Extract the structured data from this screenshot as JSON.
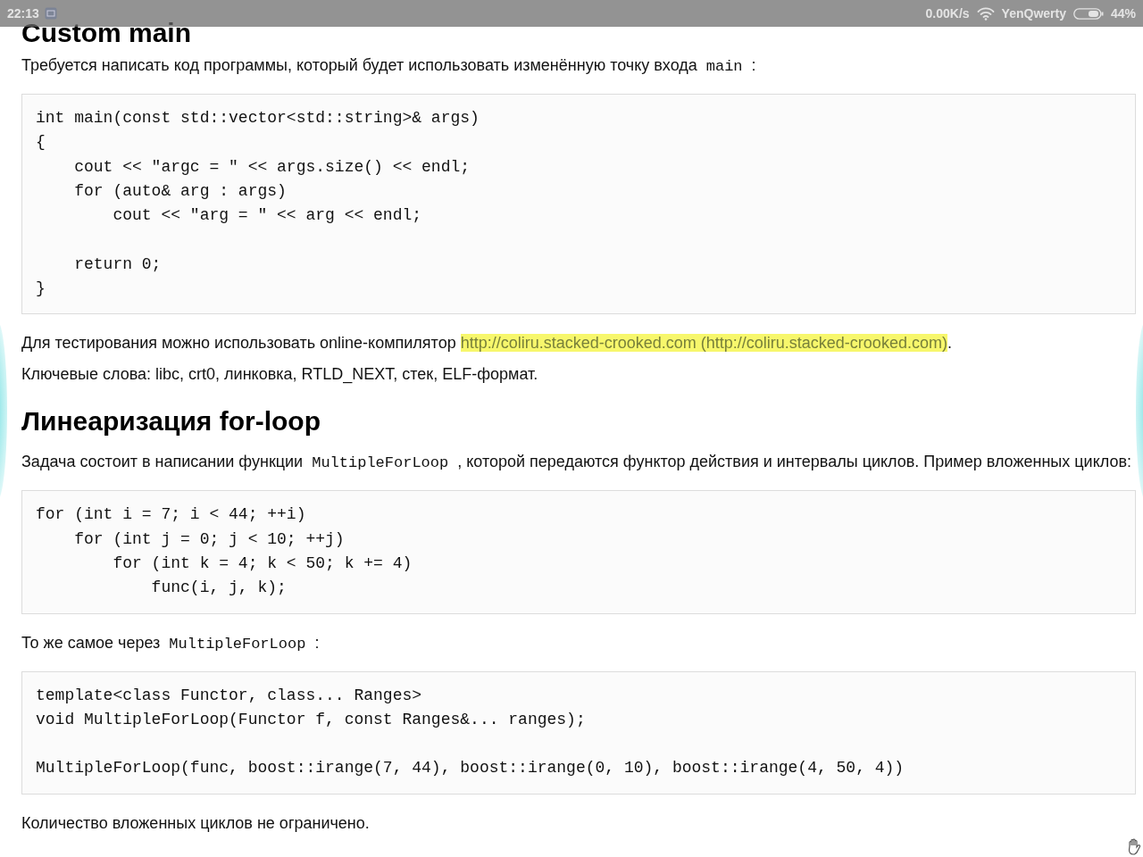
{
  "status_bar": {
    "time": "22:13",
    "network_speed": "0.00K/s",
    "wifi_name": "YenQwerty",
    "battery": "44%"
  },
  "article": [
    {
      "kind": "heading",
      "text": "Custom main"
    },
    {
      "kind": "paragraph",
      "parts": [
        {
          "kind": "text",
          "text": "Требуется написать код программы, который будет использовать изменённую точку входа "
        },
        {
          "kind": "code",
          "text": "main"
        },
        {
          "kind": "text",
          "text": " :"
        }
      ]
    },
    {
      "kind": "code",
      "text": "int main(const std::vector<std::string>& args)\n{\n    cout << \"argc = \" << args.size() << endl;\n    for (auto& arg : args)\n        cout << \"arg = \" << arg << endl;\n\n    return 0;\n}"
    },
    {
      "kind": "paragraph",
      "parts": [
        {
          "kind": "text",
          "text": "Для тестирования можно использовать online-компилятор "
        },
        {
          "kind": "link",
          "text": "http://coliru.stacked-crooked.com (http://coliru.stacked-crooked.com)"
        },
        {
          "kind": "text",
          "text": "."
        }
      ]
    },
    {
      "kind": "paragraph",
      "parts": [
        {
          "kind": "text",
          "text": "Ключевые слова: libc, crt0, линковка, RTLD_NEXT, стек, ELF-формат."
        }
      ]
    },
    {
      "kind": "heading",
      "text": "Линеаризация for-loop"
    },
    {
      "kind": "paragraph",
      "parts": [
        {
          "kind": "text",
          "text": "Задача состоит в написании функции "
        },
        {
          "kind": "code",
          "text": "MultipleForLoop"
        },
        {
          "kind": "text",
          "text": " , которой передаются функтор действия и интервалы циклов. Пример вложенных циклов:"
        }
      ]
    },
    {
      "kind": "code",
      "text": "for (int i = 7; i < 44; ++i)\n    for (int j = 0; j < 10; ++j)\n        for (int k = 4; k < 50; k += 4)\n            func(i, j, k);"
    },
    {
      "kind": "paragraph",
      "parts": [
        {
          "kind": "text",
          "text": "То же самое через "
        },
        {
          "kind": "code",
          "text": "MultipleForLoop"
        },
        {
          "kind": "text",
          "text": " :"
        }
      ]
    },
    {
      "kind": "code",
      "text": "template<class Functor, class... Ranges>\nvoid MultipleForLoop(Functor f, const Ranges&... ranges);\n\nMultipleForLoop(func, boost::irange(7, 44), boost::irange(0, 10), boost::irange(4, 50, 4))"
    },
    {
      "kind": "paragraph",
      "parts": [
        {
          "kind": "text",
          "text": "Количество вложенных циклов не ограничено."
        }
      ]
    }
  ]
}
